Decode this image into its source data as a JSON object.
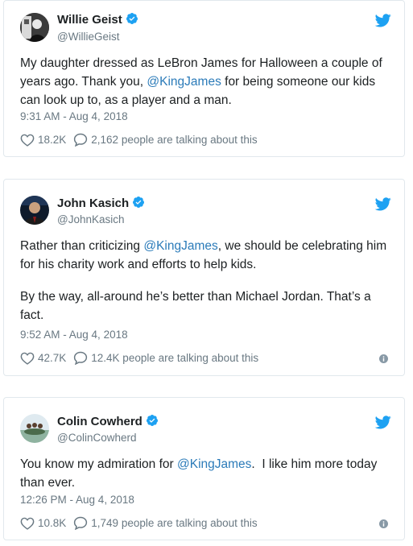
{
  "tweets": [
    {
      "name": "Willie Geist",
      "handle": "@WillieGeist",
      "text_before": "My daughter dressed as LeBron James for Halloween a couple of years ago. Thank you, ",
      "mention": "@KingJames",
      "text_after": " for being someone our kids can look up to, as a player and a man.",
      "time": "9:31 AM - Aug 4, 2018",
      "likes": "18.2K",
      "talking": "2,162 people are talking about this"
    },
    {
      "name": "John Kasich",
      "handle": "@JohnKasich",
      "text_before": "Rather than criticizing ",
      "mention": "@KingJames",
      "text_after": ", we should be celebrating him for his charity work and efforts to help kids.",
      "text_para2": "By the way, all-around he’s better than Michael Jordan. That’s a fact.",
      "time": "9:52 AM - Aug 4, 2018",
      "likes": "42.7K",
      "talking": "12.4K people are talking about this"
    },
    {
      "name": "Colin Cowherd",
      "handle": "@ColinCowherd",
      "text_before": "You know my admiration for ",
      "mention": "@KingJames",
      "text_after": ".  I like him more today than ever.",
      "time": "12:26 PM - Aug 4, 2018",
      "likes": "10.8K",
      "talking": "1,749 people are talking about this"
    }
  ],
  "colors": {
    "link": "#2b7bb9",
    "twitter_blue": "#1da1f2",
    "muted": "#697882",
    "border": "#e1e8ed"
  },
  "icons": [
    "verified-badge-icon",
    "twitter-bird-icon",
    "heart-icon",
    "reply-bubble-icon",
    "info-icon"
  ]
}
